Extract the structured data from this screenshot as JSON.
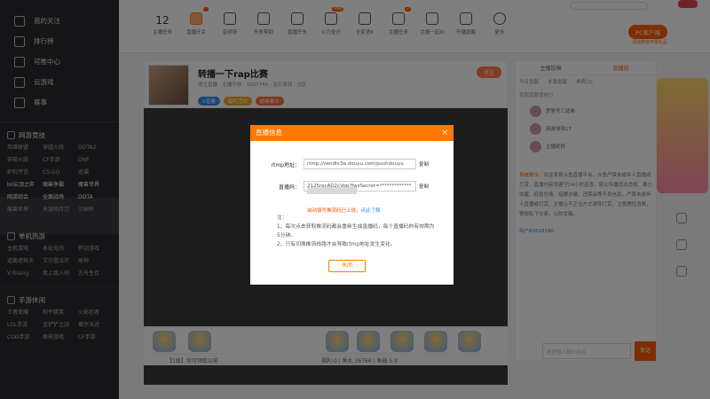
{
  "sidebar": {
    "items": [
      {
        "label": "我的关注"
      },
      {
        "label": "排行榜"
      },
      {
        "label": "可推中心"
      },
      {
        "label": "云游戏"
      },
      {
        "label": "赛事"
      }
    ],
    "sections": [
      {
        "title": "网游竞技",
        "entries": [
          "英雄联盟",
          "穿越火线",
          "DOTA2",
          "穿梭火线",
          "CF手游",
          "DNF",
          "炉石传说",
          "CS:GO",
          "逃课",
          "lol云顶之弈",
          "魔兽争霸",
          "魔兽世界",
          "网游综合",
          "全面战场",
          "DOTA",
          "魔兽世界",
          "天涯明月刀",
          "三国杀"
        ]
      },
      {
        "title": "单机热游",
        "entries": [
          "主机游戏",
          "永劫无间",
          "怀旧游戏",
          "逃离塔科夫",
          "艾尔登法环",
          "原神",
          "V Rising",
          "我上我人间",
          "方舟生存"
        ]
      },
      {
        "title": "手游休闲",
        "entries": [
          "王者荣耀",
          "和平精英",
          "火影忍者",
          "LOL手游",
          "金铲铲之战",
          "蛋仔派对",
          "COD手游",
          "原神游戏",
          "CF手游"
        ]
      }
    ]
  },
  "topbar": {
    "level_num": "12",
    "items": [
      {
        "label": "主播任务"
      },
      {
        "label": "直播开关",
        "badge": "!"
      },
      {
        "label": "音频设"
      },
      {
        "label": "头条帮助"
      },
      {
        "label": "直播开头"
      },
      {
        "label": "火力全开",
        "badge": "999"
      },
      {
        "label": "全民语K"
      },
      {
        "label": "主播任务",
        "badge": "2"
      },
      {
        "label": "主播一起玩"
      },
      {
        "label": "开播提醒"
      },
      {
        "label": "更多"
      }
    ],
    "pc_client_button": "PC客户端",
    "pc_client_sub": "活动赠送丰厚礼品"
  },
  "room": {
    "title": "转播一下rap比赛",
    "meta": "房主直播 · 主播开放 · 1007749 · 音乐游戏 · 分区",
    "tags": [
      "V直播",
      "福利活动",
      "超级暴击"
    ],
    "follow_label": "关注"
  },
  "dialog": {
    "title": "直播信息",
    "close": "×",
    "rtmp_label": "rtmp地址：",
    "rtmp_value": "rtmp://sendtc3a.douyu.com/pushdouyu",
    "code_label": "直播码：",
    "code_value": "2125recAQ2cVop?fwsSecret=*************",
    "copy_label": "复制",
    "warning": "自动填写推流码已上线，",
    "warning_link": "点此了解",
    "notes_title": "注：",
    "note1": "1、每次点击获取推流码都会重新生成直播码，每个直播码的有效期为5分钟。",
    "note2": "2、只有切换推流线路才会导致rtmp地址发生变化。",
    "close_button": "关闭"
  },
  "right_panel": {
    "tabs": [
      "主播投稿",
      "直播间"
    ],
    "subtabs": [
      "今日贡献",
      "本周贡献",
      "贵宾(1)"
    ],
    "rank_title": "按照贡献值排行",
    "rank": [
      {
        "name": "罗警号三犹骨"
      },
      {
        "name": "网游领导17"
      },
      {
        "name": "主播昵称"
      }
    ],
    "notice_label": "系统提示：",
    "notice": "欢迎来到斗鱼直播平台，斗鱼严禁未成年人直播或打赏，直播内容须遵守24小时巡查，禁止传播违法违规、暴力血腥、低俗色情、招嫖诈骗、违禁品等不良信息，严禁未成年人直播或打赏，主播以不正当方式诱导打赏，注意理性消费，警惕私下交易，以防受骗。",
    "user_line": "用户82618190",
    "input_placeholder": "这里输入聊天内容",
    "send_label": "发送"
  },
  "bottom": {
    "strip_text": "【1级】你可领取以前",
    "stats": "福利:0 | 鱼丸 26766 | 鱼翅 5.9"
  }
}
